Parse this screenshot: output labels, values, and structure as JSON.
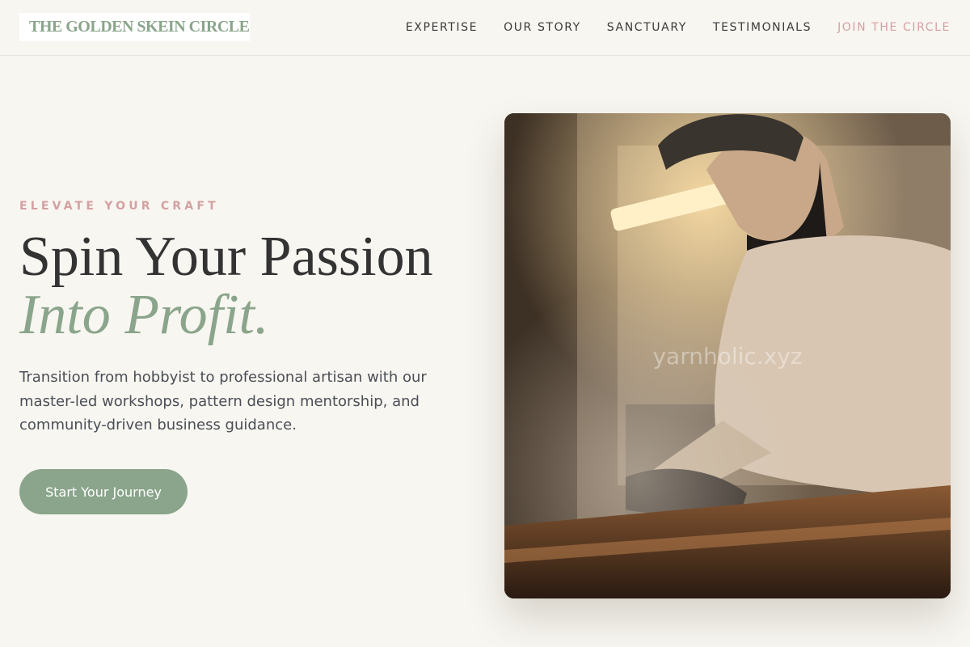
{
  "header": {
    "logo": "THE GOLDEN SKEIN CIRCLE",
    "nav": [
      "EXPERTISE",
      "OUR STORY",
      "SANCTUARY",
      "TESTIMONIALS",
      "JOIN THE CIRCLE"
    ]
  },
  "hero": {
    "eyebrow": "ELEVATE YOUR CRAFT",
    "headline_line1": "Spin Your Passion",
    "headline_line2": "Into Profit.",
    "description": "Transition from hobbyist to professional artisan with our master-led workshops, pattern design mentorship, and community-driven business guidance.",
    "cta": "Start Your Journey",
    "image_watermark": "yarnholic.xyz"
  },
  "colors": {
    "background": "#f8f6f1",
    "sage": "#8aa58b",
    "rose": "#d4a0a1",
    "text": "#333333"
  }
}
